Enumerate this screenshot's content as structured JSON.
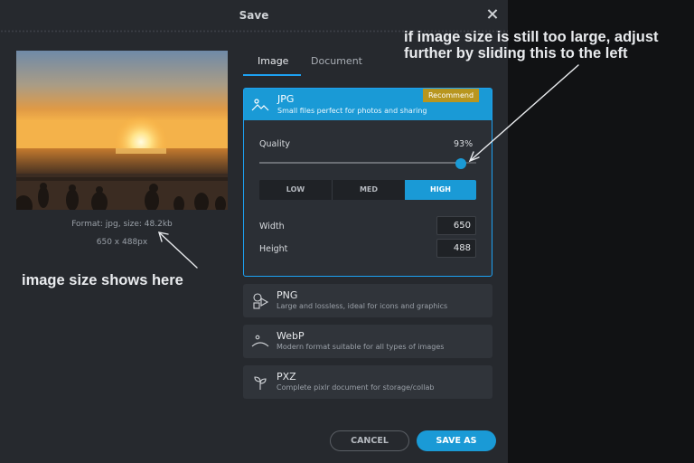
{
  "dialog": {
    "title": "Save",
    "preview": {
      "format_text": "Format: jpg, size: 48.2kb",
      "dimensions_text": "650 x 488px"
    },
    "tabs": [
      {
        "label": "Image",
        "active": true
      },
      {
        "label": "Document",
        "active": false
      }
    ],
    "formats": {
      "jpg": {
        "title": "JPG",
        "description": "Small files perfect for photos and sharing",
        "badge": "Recommend",
        "quality_label": "Quality",
        "quality_value_text": "93%",
        "quality_value": 93,
        "presets": [
          "LOW",
          "MED",
          "HIGH"
        ],
        "selected_preset": "HIGH",
        "width_label": "Width",
        "width_value": "650",
        "height_label": "Height",
        "height_value": "488"
      },
      "png": {
        "title": "PNG",
        "description": "Large and lossless, ideal for icons and graphics"
      },
      "webp": {
        "title": "WebP",
        "description": "Modern format suitable for all types of images"
      },
      "pxz": {
        "title": "PXZ",
        "description": "Complete pixlr document for storage/collab"
      }
    },
    "buttons": {
      "cancel": "CANCEL",
      "save_as": "SAVE AS"
    }
  },
  "annotations": {
    "slider_note_line1": "if image size is still too large, adjust",
    "slider_note_line2": "further by sliding this to the left",
    "size_note": "image size shows here"
  },
  "colors": {
    "accent": "#1a9ad6",
    "badge": "#b8961f",
    "dialog_bg": "#26292e",
    "backdrop": "#111214"
  }
}
